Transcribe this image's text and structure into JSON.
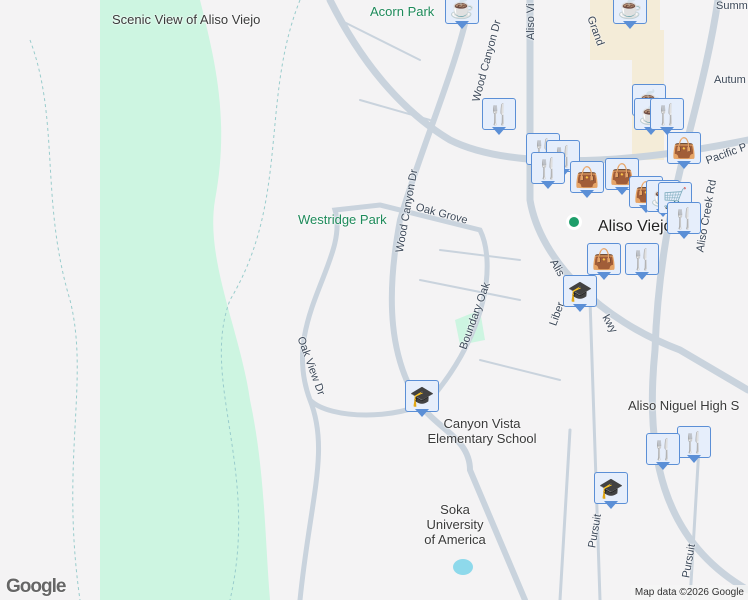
{
  "labels": {
    "scenic_view": "Scenic View of Aliso Viejo",
    "acorn_park": "Acorn Park",
    "aliso_viejo_pkwy_top": "Aliso Vi",
    "grand": "Grand",
    "summit": "Summ",
    "autumn": "Autum",
    "pacific": "Pacific P",
    "aliso_creek_rd": "Aliso Creek Rd",
    "wood_canyon_1": "Wood Canyon Dr",
    "wood_canyon_2": "Wood Canyon Dr",
    "westridge_park": "Westridge Park",
    "oak_grove": "Oak Grove",
    "aliso_viejo": "Aliso Viejo",
    "boundary_oak": "Boundary Oak",
    "alis_pkwy": "Alis",
    "liberty_pkwy": "Liber",
    "pkwy": "kwy",
    "oak_view_dr": "Oak View Dr",
    "aliso_niguel": "Aliso Niguel High S",
    "canyon_vista": "Canyon Vista Elementary School",
    "soka": "Soka University of America",
    "pursuit_1": "Pursuit",
    "pursuit_2": "Pursuit"
  },
  "attribution": "Map data ©2026 Google",
  "logo": "Google",
  "colors": {
    "park": "#cdf5e1",
    "road": "#c9d3dd",
    "marker": "#0d3b66",
    "water": "#8ed9eb"
  }
}
